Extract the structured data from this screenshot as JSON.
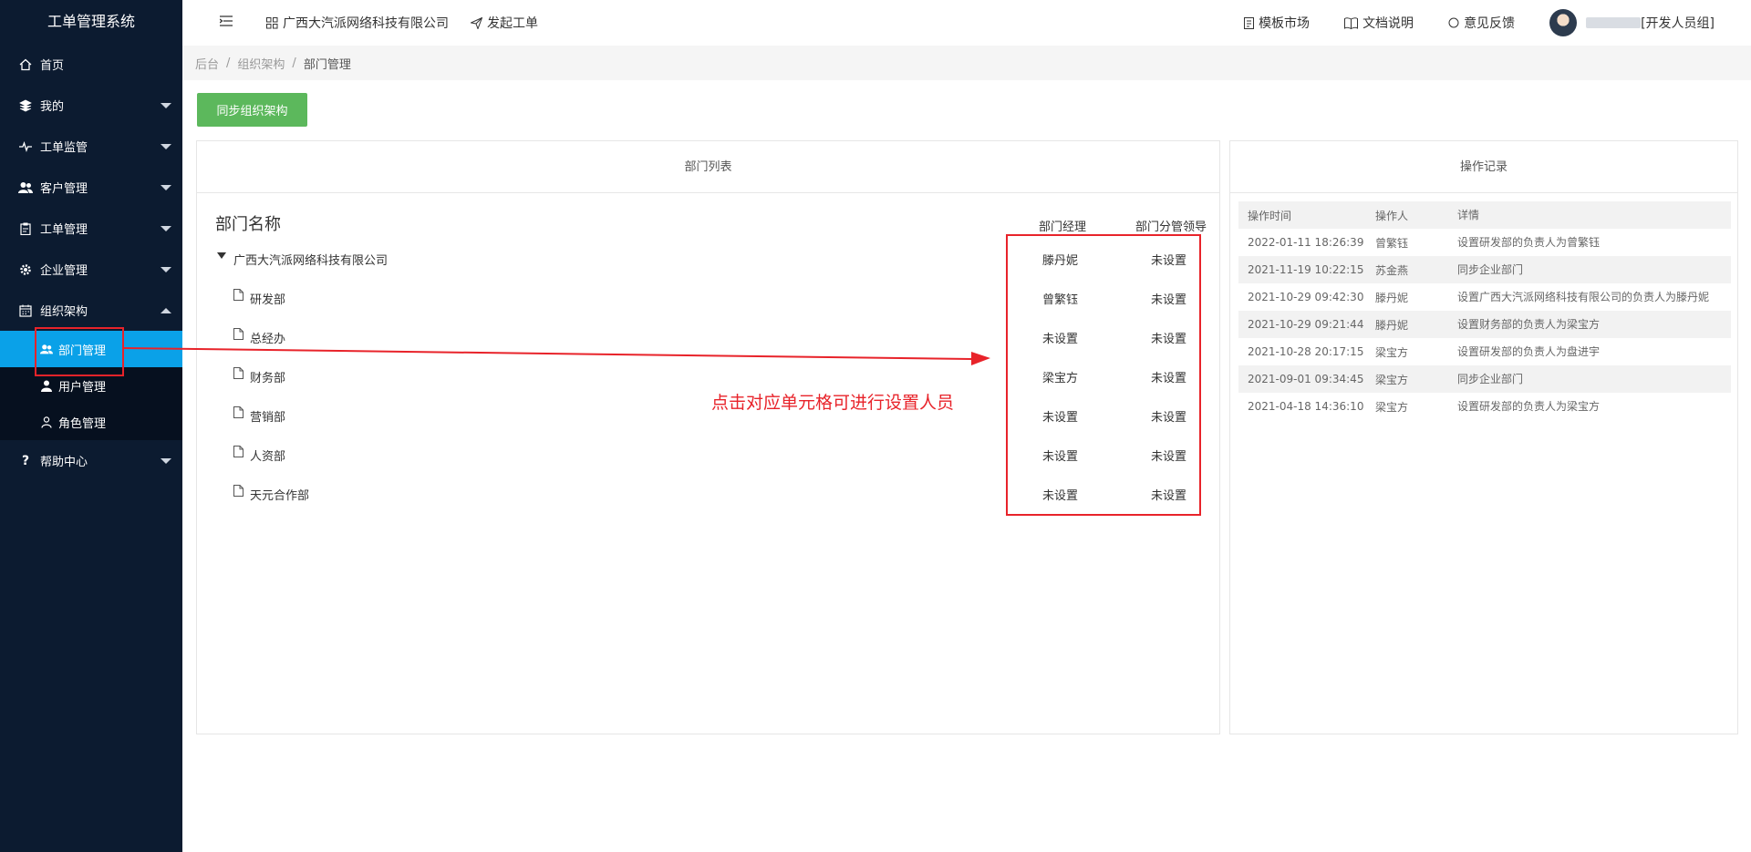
{
  "app": {
    "title": "工单管理系统"
  },
  "sidebar": {
    "items": [
      {
        "label": "首页",
        "icon": "home-icon"
      },
      {
        "label": "我的",
        "icon": "layers-icon"
      },
      {
        "label": "工单监管",
        "icon": "pulse-icon"
      },
      {
        "label": "客户管理",
        "icon": "users-icon"
      },
      {
        "label": "工单管理",
        "icon": "clipboard-icon"
      },
      {
        "label": "企业管理",
        "icon": "gear-icon"
      },
      {
        "label": "组织架构",
        "icon": "calendar-icon"
      },
      {
        "label": "帮助中心",
        "icon": "question-icon"
      }
    ],
    "subitems": [
      {
        "label": "部门管理",
        "icon": "users-icon",
        "active": true
      },
      {
        "label": "用户管理",
        "icon": "user-icon"
      },
      {
        "label": "角色管理",
        "icon": "user-outline-icon"
      }
    ]
  },
  "header": {
    "company": "广西大汽派网络科技有限公司",
    "create_order": "发起工单",
    "template_market": "模板市场",
    "docs": "文档说明",
    "feedback": "意见反馈",
    "user_group": "[开发人员组]"
  },
  "breadcrumb": [
    "后台",
    "组织架构",
    "部门管理"
  ],
  "sync_button": "同步组织架构",
  "dept_panel": {
    "title": "部门列表",
    "col_name": "部门名称",
    "col_manager": "部门经理",
    "col_leader": "部门分管领导",
    "rows": [
      {
        "name": "广西大汽派网络科技有限公司",
        "manager": "滕丹妮",
        "leader": "未设置"
      },
      {
        "name": "研发部",
        "manager": "曾繁钰",
        "leader": "未设置"
      },
      {
        "name": "总经办",
        "manager": "未设置",
        "leader": "未设置"
      },
      {
        "name": "财务部",
        "manager": "梁宝方",
        "leader": "未设置"
      },
      {
        "name": "营销部",
        "manager": "未设置",
        "leader": "未设置"
      },
      {
        "name": "人资部",
        "manager": "未设置",
        "leader": "未设置"
      },
      {
        "name": "天元合作部",
        "manager": "未设置",
        "leader": "未设置"
      }
    ],
    "annotation": "点击对应单元格可进行设置人员"
  },
  "log_panel": {
    "title": "操作记录",
    "headers": [
      "操作时间",
      "操作人",
      "详情"
    ],
    "rows": [
      {
        "time": "2022-01-11 18:26:39",
        "user": "曾繁钰",
        "detail": "设置研发部的负责人为曾繁钰"
      },
      {
        "time": "2021-11-19 10:22:15",
        "user": "苏金燕",
        "detail": "同步企业部门"
      },
      {
        "time": "2021-10-29 09:42:30",
        "user": "滕丹妮",
        "detail": "设置广西大汽派网络科技有限公司的负责人为滕丹妮"
      },
      {
        "time": "2021-10-29 09:21:44",
        "user": "滕丹妮",
        "detail": "设置财务部的负责人为梁宝方"
      },
      {
        "time": "2021-10-28 20:17:15",
        "user": "梁宝方",
        "detail": "设置研发部的负责人为盘进宇"
      },
      {
        "time": "2021-09-01 09:34:45",
        "user": "梁宝方",
        "detail": "同步企业部门"
      },
      {
        "time": "2021-04-18 14:36:10",
        "user": "梁宝方",
        "detail": "设置研发部的负责人为梁宝方"
      }
    ]
  },
  "colors": {
    "sidebar_bg": "#0c1b30",
    "active": "#0aa1e8",
    "success": "#5cb85c",
    "annotation": "#e8232a"
  }
}
